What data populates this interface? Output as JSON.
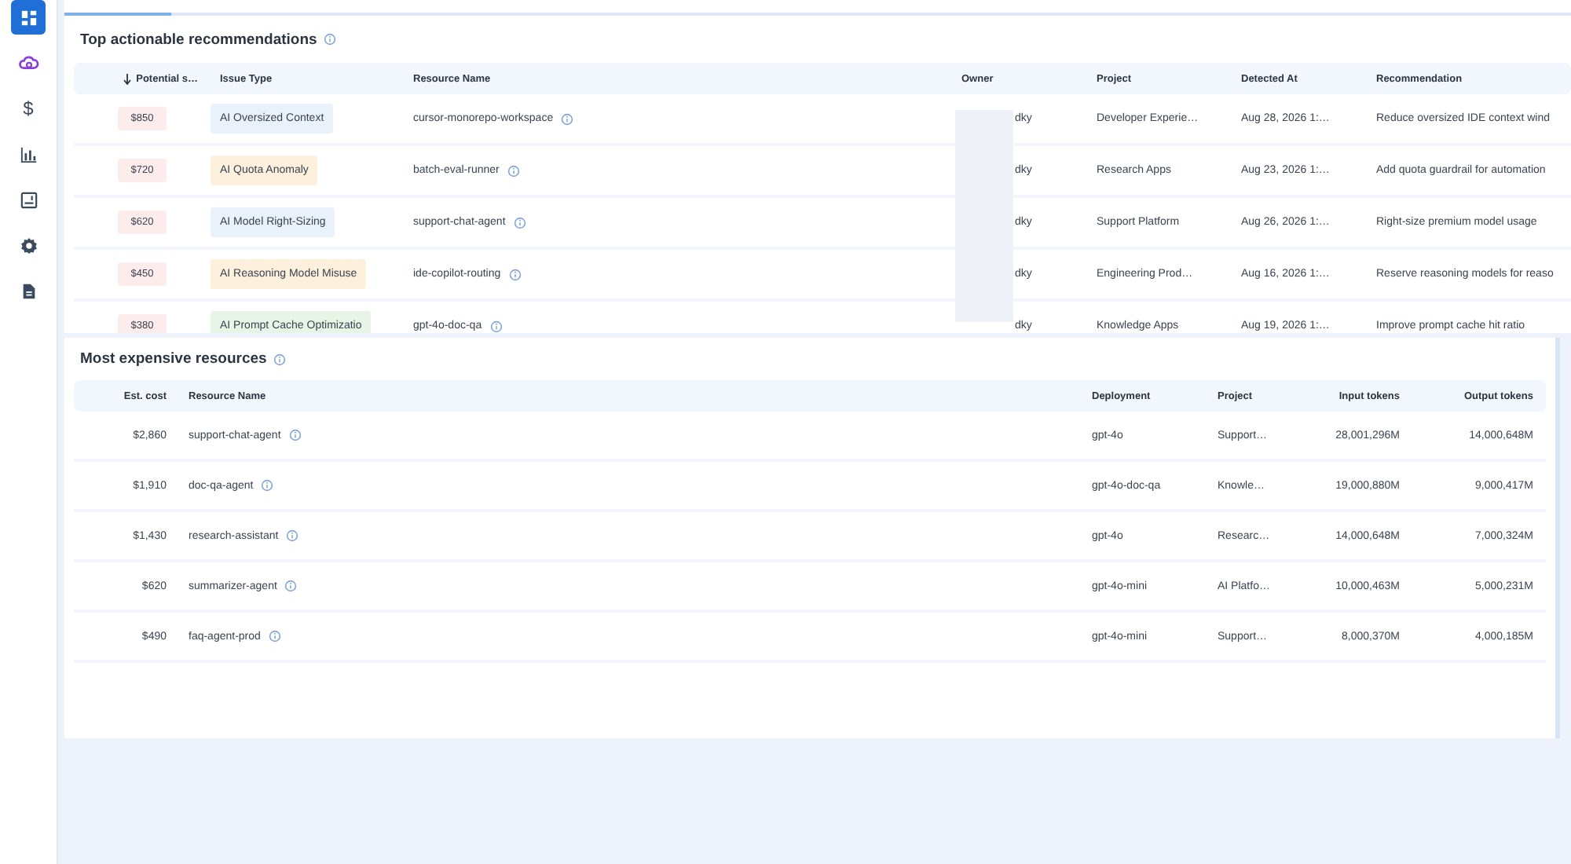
{
  "sidebar": {
    "items": [
      {
        "kind": "grid",
        "selected": true
      },
      {
        "kind": "cloud",
        "selected": false
      },
      {
        "kind": "glyph",
        "glyph": "$",
        "selected": false
      },
      {
        "kind": "chart",
        "selected": false
      },
      {
        "kind": "report",
        "selected": false
      },
      {
        "kind": "gear",
        "selected": false
      },
      {
        "kind": "document",
        "selected": false
      }
    ]
  },
  "recommendations": {
    "title": "Top actionable recommendations",
    "columns": [
      "Potential s…",
      "Issue Type",
      "Resource Name",
      "Owner",
      "Project",
      "Detected At",
      "Recommendation"
    ],
    "rows": [
      {
        "savings": "$850",
        "issue": "AI Oversized Context",
        "color": "#e9f1fb",
        "resource": "cursor-monorepo-workspace",
        "owner": "dky",
        "project": "Developer Experie…",
        "detected": "Aug 28, 2026 1:…",
        "recommendation": "Reduce oversized IDE context wind"
      },
      {
        "savings": "$720",
        "issue": "AI Quota Anomaly",
        "color": "#fdf1de",
        "resource": "batch-eval-runner",
        "owner": "dky",
        "project": "Research Apps",
        "detected": "Aug 23, 2026 1:…",
        "recommendation": "Add quota guardrail for automation"
      },
      {
        "savings": "$620",
        "issue": "AI Model Right-Sizing",
        "color": "#e9f1fb",
        "resource": "support-chat-agent",
        "owner": "dky",
        "project": "Support Platform",
        "detected": "Aug 26, 2026 1:…",
        "recommendation": "Right-size premium model usage"
      },
      {
        "savings": "$450",
        "issue": "AI Reasoning Model Misuse",
        "color": "#fdf1de",
        "resource": "ide-copilot-routing",
        "owner": "dky",
        "project": "Engineering Prod…",
        "detected": "Aug 16, 2026 1:…",
        "recommendation": "Reserve reasoning models for reaso"
      },
      {
        "savings": "$380",
        "issue": "AI Prompt Cache Optimizatio",
        "color": "#e6f5e6",
        "resource": "gpt-4o-doc-qa",
        "owner": "dky",
        "project": "Knowledge Apps",
        "detected": "Aug 19, 2026 1:…",
        "recommendation": "Improve prompt cache hit ratio"
      }
    ]
  },
  "expensive": {
    "title": "Most expensive resources",
    "columns": [
      "Est. cost",
      "Resource Name",
      "Deployment",
      "Project",
      "Input tokens",
      "Output tokens"
    ],
    "rows": [
      {
        "cost": "$2,860",
        "resource": "support-chat-agent",
        "deployment": "gpt-4o",
        "project": "Support…",
        "input": "28,001,296M",
        "output": "14,000,648M"
      },
      {
        "cost": "$1,910",
        "resource": "doc-qa-agent",
        "deployment": "gpt-4o-doc-qa",
        "project": "Knowle…",
        "input": "19,000,880M",
        "output": "9,000,417M"
      },
      {
        "cost": "$1,430",
        "resource": "research-assistant",
        "deployment": "gpt-4o",
        "project": "Researc…",
        "input": "14,000,648M",
        "output": "7,000,324M"
      },
      {
        "cost": "$620",
        "resource": "summarizer-agent",
        "deployment": "gpt-4o-mini",
        "project": "AI Platfo…",
        "input": "10,000,463M",
        "output": "5,000,231M"
      },
      {
        "cost": "$490",
        "resource": "faq-agent-prod",
        "deployment": "gpt-4o-mini",
        "project": "Support…",
        "input": "8,000,370M",
        "output": "4,000,185M"
      }
    ]
  }
}
